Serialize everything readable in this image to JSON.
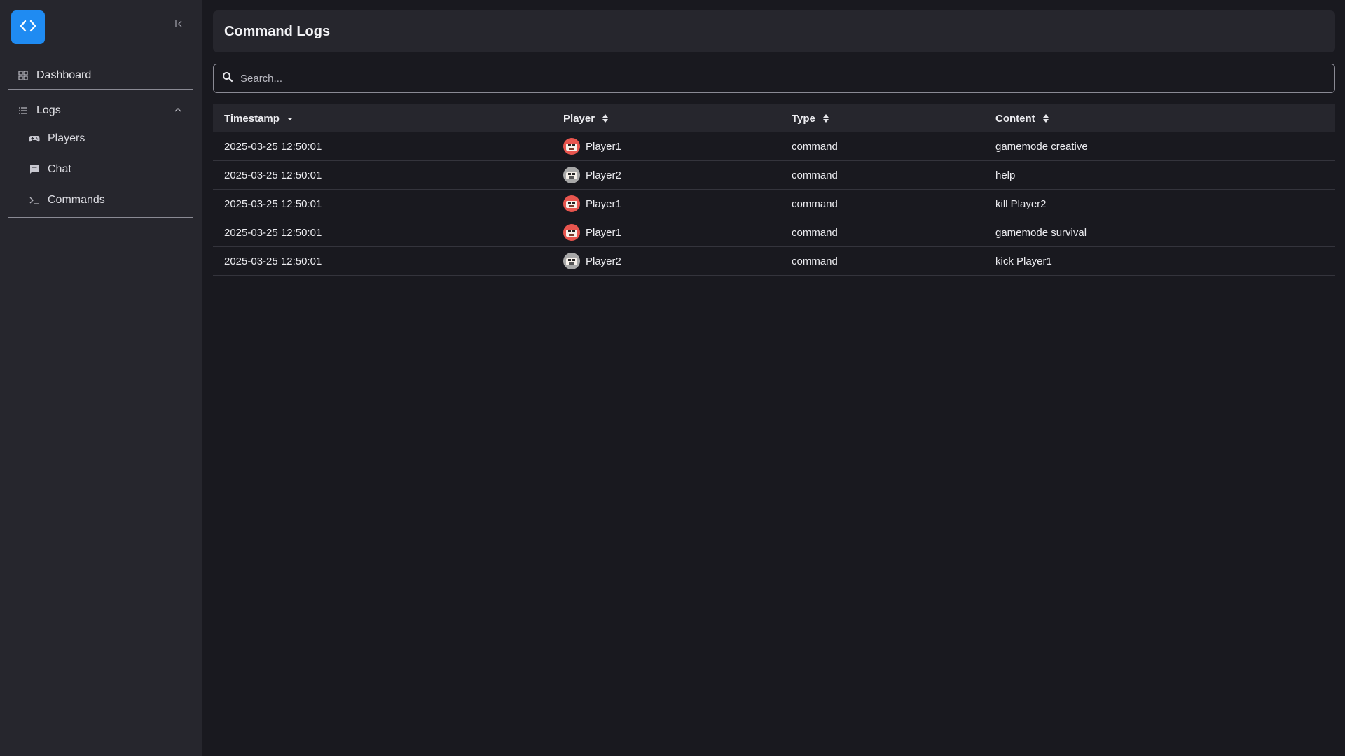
{
  "sidebar": {
    "logo_icon": "code-brackets-icon",
    "brand_color": "#1f8bf2",
    "items": {
      "dashboard": {
        "label": "Dashboard",
        "icon": "grid-icon"
      },
      "logs": {
        "label": "Logs",
        "icon": "list-icon",
        "expanded": true
      },
      "players": {
        "label": "Players",
        "icon": "gamepad-icon"
      },
      "chat": {
        "label": "Chat",
        "icon": "chat-icon"
      },
      "commands": {
        "label": "Commands",
        "icon": "terminal-icon"
      }
    }
  },
  "page": {
    "title": "Command Logs"
  },
  "search": {
    "placeholder": "Search...",
    "value": ""
  },
  "table": {
    "columns": [
      "Timestamp",
      "Player",
      "Type",
      "Content"
    ],
    "sort": {
      "column": "Timestamp",
      "direction": "desc"
    },
    "rows": [
      {
        "timestamp": "2025-03-25 12:50:01",
        "player": "Player1",
        "type": "command",
        "content": "gamemode creative"
      },
      {
        "timestamp": "2025-03-25 12:50:01",
        "player": "Player2",
        "type": "command",
        "content": "help"
      },
      {
        "timestamp": "2025-03-25 12:50:01",
        "player": "Player1",
        "type": "command",
        "content": "kill Player2"
      },
      {
        "timestamp": "2025-03-25 12:50:01",
        "player": "Player1",
        "type": "command",
        "content": "gamemode survival"
      },
      {
        "timestamp": "2025-03-25 12:50:01",
        "player": "Player2",
        "type": "command",
        "content": "kick Player1"
      }
    ]
  }
}
